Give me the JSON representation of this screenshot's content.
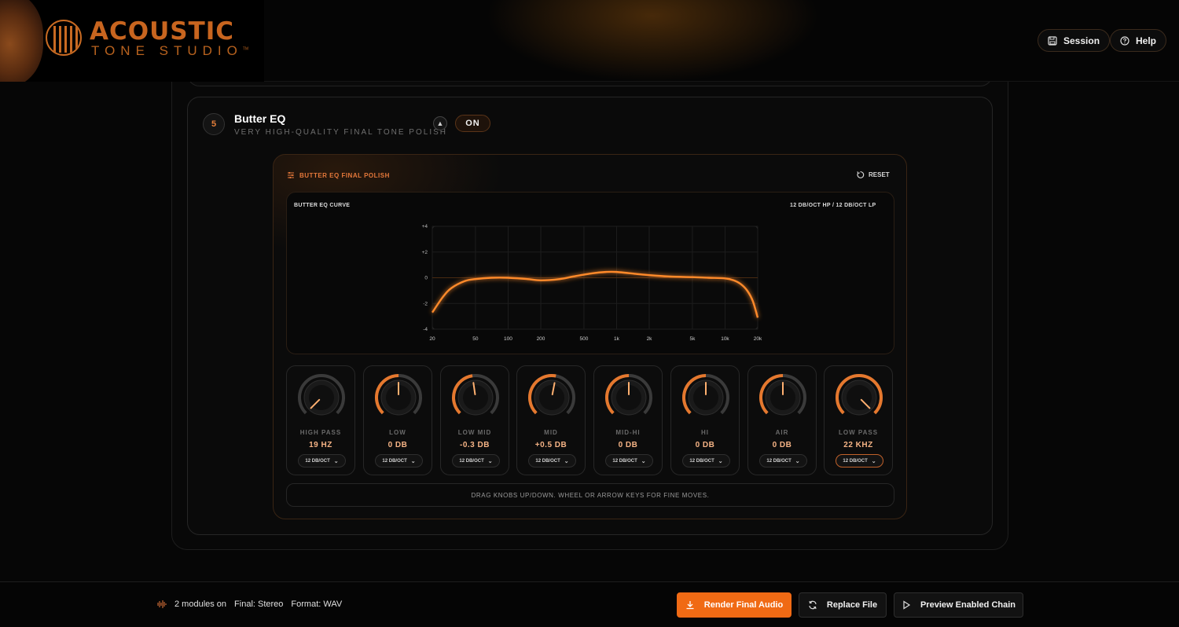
{
  "brand": {
    "title": "ACOUSTIC",
    "subtitle": "TONE STUDIO",
    "tm": "TM"
  },
  "header": {
    "session_label": "Session",
    "help_label": "Help"
  },
  "module": {
    "number": "5",
    "title": "Butter EQ",
    "subtitle": "VERY HIGH-QUALITY FINAL TONE POLISH",
    "toggle_label": "ON"
  },
  "eq": {
    "panel_title": "BUTTER EQ FINAL POLISH",
    "reset_label": "RESET",
    "curve_label": "BUTTER EQ CURVE",
    "slope_info": "12 DB/OCT HP / 12 DB/OCT LP",
    "hint": "DRAG KNOBS UP/DOWN. WHEEL OR ARROW KEYS FOR FINE MOVES.",
    "knobs": [
      {
        "label": "HIGH PASS",
        "value": "19 HZ",
        "slope": "12 DB/OCT",
        "level": 0.0
      },
      {
        "label": "LOW",
        "value": "0 DB",
        "slope": "12 DB/OCT",
        "level": 0.5
      },
      {
        "label": "LOW MID",
        "value": "-0.3 DB",
        "slope": "12 DB/OCT",
        "level": 0.47
      },
      {
        "label": "MID",
        "value": "+0.5 DB",
        "slope": "12 DB/OCT",
        "level": 0.54
      },
      {
        "label": "MID-HI",
        "value": "0 DB",
        "slope": "12 DB/OCT",
        "level": 0.5
      },
      {
        "label": "HI",
        "value": "0 DB",
        "slope": "12 DB/OCT",
        "level": 0.5
      },
      {
        "label": "AIR",
        "value": "0 DB",
        "slope": "12 DB/OCT",
        "level": 0.5
      },
      {
        "label": "LOW PASS",
        "value": "22 KHZ",
        "slope": "12 DB/OCT",
        "level": 1.0
      }
    ]
  },
  "chart_data": {
    "type": "line",
    "title": "",
    "xlabel": "",
    "ylabel": "",
    "x_scale": "log",
    "xlim": [
      20,
      20000
    ],
    "ylim": [
      -4,
      4
    ],
    "x_ticks": [
      "20",
      "50",
      "100",
      "200",
      "500",
      "1k",
      "2k",
      "5k",
      "10k",
      "20k"
    ],
    "y_ticks": [
      "+4",
      "+2",
      "0",
      "-2",
      "-4"
    ],
    "grid": true,
    "series": [
      {
        "x": [
          20,
          25,
          30,
          40,
          50,
          70,
          100,
          150,
          200,
          300,
          400,
          600,
          800,
          1000,
          1500,
          2000,
          3000,
          5000,
          7000,
          10000,
          12000,
          14000,
          16000,
          18000,
          20000
        ],
        "y": [
          -2.7,
          -1.5,
          -0.8,
          -0.25,
          -0.1,
          0.0,
          0.0,
          -0.1,
          -0.2,
          -0.1,
          0.1,
          0.35,
          0.45,
          0.45,
          0.3,
          0.2,
          0.1,
          0.05,
          0.0,
          -0.05,
          -0.2,
          -0.5,
          -1.0,
          -1.8,
          -3.1
        ]
      }
    ]
  },
  "footer": {
    "modules_on": "2 modules on",
    "final": "Final: Stereo",
    "format": "Format: WAV",
    "render_label": "Render Final Audio",
    "replace_label": "Replace File",
    "preview_label": "Preview Enabled Chain"
  },
  "colors": {
    "accent": "#f06a14",
    "curve": "#ff8a2a",
    "text_accent": "#f5b385"
  }
}
